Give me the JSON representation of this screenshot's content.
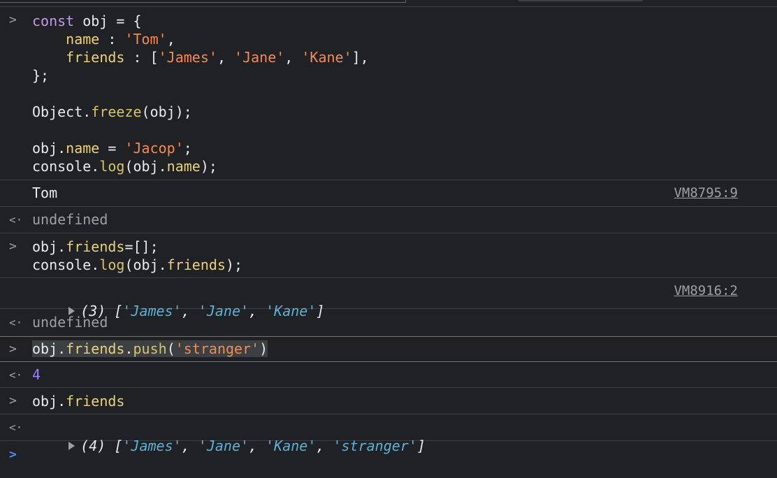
{
  "entries": {
    "e1": {
      "lines": [
        [
          {
            "t": "const",
            "c": "kw"
          },
          {
            "t": " obj = {",
            "c": "plain"
          }
        ],
        [
          {
            "t": "    ",
            "c": "plain"
          },
          {
            "t": "name",
            "c": "prop"
          },
          {
            "t": " : ",
            "c": "plain"
          },
          {
            "t": "'Tom'",
            "c": "str"
          },
          {
            "t": ",",
            "c": "plain"
          }
        ],
        [
          {
            "t": "    ",
            "c": "plain"
          },
          {
            "t": "friends",
            "c": "prop"
          },
          {
            "t": " : [",
            "c": "plain"
          },
          {
            "t": "'James'",
            "c": "str"
          },
          {
            "t": ", ",
            "c": "plain"
          },
          {
            "t": "'Jane'",
            "c": "str"
          },
          {
            "t": ", ",
            "c": "plain"
          },
          {
            "t": "'Kane'",
            "c": "str"
          },
          {
            "t": "],",
            "c": "plain"
          }
        ],
        [
          {
            "t": "};",
            "c": "plain"
          }
        ],
        [
          {
            "t": "",
            "c": "plain"
          }
        ],
        [
          {
            "t": "Object.",
            "c": "plain"
          },
          {
            "t": "freeze",
            "c": "fn"
          },
          {
            "t": "(obj);",
            "c": "plain"
          }
        ],
        [
          {
            "t": "",
            "c": "plain"
          }
        ],
        [
          {
            "t": "obj.",
            "c": "plain"
          },
          {
            "t": "name",
            "c": "prop"
          },
          {
            "t": " = ",
            "c": "plain"
          },
          {
            "t": "'Jacop'",
            "c": "str"
          },
          {
            "t": ";",
            "c": "plain"
          }
        ],
        [
          {
            "t": "console.",
            "c": "plain"
          },
          {
            "t": "log",
            "c": "fn"
          },
          {
            "t": "(obj.",
            "c": "plain"
          },
          {
            "t": "name",
            "c": "prop"
          },
          {
            "t": ");",
            "c": "plain"
          }
        ]
      ]
    },
    "o1": {
      "text": "Tom",
      "source": "VM8795:9"
    },
    "r1": {
      "text": "undefined"
    },
    "e2": {
      "lines": [
        [
          {
            "t": "obj.",
            "c": "plain"
          },
          {
            "t": "friends",
            "c": "prop"
          },
          {
            "t": "=[];",
            "c": "plain"
          }
        ],
        [
          {
            "t": "console.",
            "c": "plain"
          },
          {
            "t": "log",
            "c": "fn"
          },
          {
            "t": "(obj.",
            "c": "plain"
          },
          {
            "t": "friends",
            "c": "prop"
          },
          {
            "t": ");",
            "c": "plain"
          }
        ]
      ]
    },
    "o2": {
      "parts": [
        {
          "t": "(3) [",
          "c": "arrcnt"
        },
        {
          "t": "'James'",
          "c": "arrstr"
        },
        {
          "t": ", ",
          "c": "arrcnt"
        },
        {
          "t": "'Jane'",
          "c": "arrstr"
        },
        {
          "t": ", ",
          "c": "arrcnt"
        },
        {
          "t": "'Kane'",
          "c": "arrstr"
        },
        {
          "t": "]",
          "c": "arrcnt"
        }
      ],
      "source": "VM8916:2"
    },
    "r2": {
      "text": "undefined"
    },
    "e3": {
      "lines": [
        [
          {
            "t": "obj.",
            "c": "plain"
          },
          {
            "t": "friends",
            "c": "prop"
          },
          {
            "t": ".",
            "c": "plain"
          },
          {
            "t": "push",
            "c": "fn"
          },
          {
            "t": "(",
            "c": "plain"
          },
          {
            "t": "'stranger'",
            "c": "str"
          },
          {
            "t": ")",
            "c": "plain"
          }
        ]
      ]
    },
    "r3": {
      "text": "4"
    },
    "e4": {
      "lines": [
        [
          {
            "t": "obj.",
            "c": "plain"
          },
          {
            "t": "friends",
            "c": "prop"
          }
        ]
      ]
    },
    "r4": {
      "parts": [
        {
          "t": "(4) [",
          "c": "arrcnt"
        },
        {
          "t": "'James'",
          "c": "arrstr"
        },
        {
          "t": ", ",
          "c": "arrcnt"
        },
        {
          "t": "'Jane'",
          "c": "arrstr"
        },
        {
          "t": ", ",
          "c": "arrcnt"
        },
        {
          "t": "'Kane'",
          "c": "arrstr"
        },
        {
          "t": ", ",
          "c": "arrcnt"
        },
        {
          "t": "'stranger'",
          "c": "arrstr"
        },
        {
          "t": "]",
          "c": "arrcnt"
        }
      ]
    }
  },
  "icons": {
    "input_prompt": "chevron-right-icon",
    "return_arrow": "return-arrow-icon",
    "expand": "expand-triangle-icon"
  },
  "colors": {
    "background": "#202124",
    "keyword": "#c39ae6",
    "property": "#e8d37a",
    "string": "#f28b54",
    "array_string": "#5db0d7",
    "number": "#9980ff",
    "prompt_active": "#4c8df6"
  }
}
